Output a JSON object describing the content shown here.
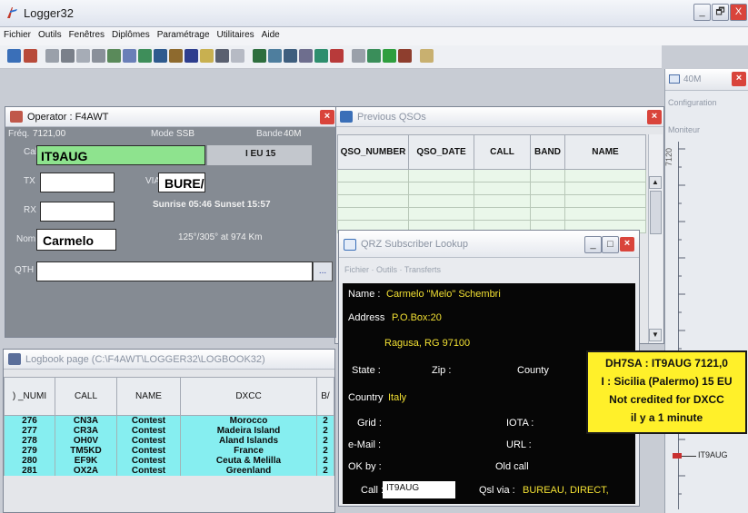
{
  "app": {
    "title": "Logger32",
    "window_buttons": [
      "_",
      "🗗",
      "X"
    ]
  },
  "menu": [
    "Fichier",
    "Outils",
    "Fenêtres",
    "Diplômes",
    "Paramétrage",
    "Utilitaires",
    "Aide"
  ],
  "operator": {
    "title": "Operator : F4AWT",
    "freq_label": "Fréq.",
    "freq": "7121,00",
    "mode_label": "Mode",
    "mode": "SSB",
    "band_label": "Bande",
    "band": "40M",
    "call_label": "Call",
    "call": "IT9AUG",
    "zone": "I EU 15",
    "tx_label": "TX",
    "via_label": "VIA",
    "via": "BURE/",
    "rx_label": "RX",
    "sun": "Sunrise 05:46 Sunset 15:57",
    "beam": "125°/305° at 974 Km",
    "nom_label": "Nom",
    "nom": "Carmelo",
    "qth_label": "QTH",
    "qth_btn": "..."
  },
  "previous_qsos": {
    "title": "Previous QSOs",
    "columns": [
      "QSO_NUMBER",
      "QSO_DATE",
      "CALL",
      "BAND",
      "NAME"
    ]
  },
  "qrz": {
    "title": "QRZ Subscriber Lookup",
    "menu": "Fichier · Outils · Transferts",
    "name_label": "Name :",
    "name": "Carmelo \"Melo\" Schembri",
    "address_label": "Address",
    "address": "P.O.Box:20",
    "city": "Ragusa, RG 97100",
    "state_label": "State :",
    "zip_label": "Zip :",
    "county_label": "County",
    "country_label": "Country",
    "country": "Italy",
    "grid_label": "Grid :",
    "iota_label": "IOTA :",
    "email_label": "e-Mail :",
    "url_label": "URL :",
    "okby_label": "OK by :",
    "oldcall_label": "Old call",
    "call_label": "Call :",
    "call": "IT9AUG",
    "qsl_label": "Qsl via :",
    "qsl": "BUREAU, DIRECT,"
  },
  "logbook": {
    "title": "Logbook page (C:\\F4AWT\\LOGGER32\\LOGBOOK32)",
    "columns": [
      ") _NUMI",
      "CALL",
      "NAME",
      "DXCC",
      "B/"
    ],
    "rows": [
      [
        "276",
        "CN3A",
        "Contest",
        "Morocco",
        "2"
      ],
      [
        "277",
        "CR3A",
        "Contest",
        "Madeira Island",
        "2"
      ],
      [
        "278",
        "OH0V",
        "Contest",
        "Aland Islands",
        "2"
      ],
      [
        "279",
        "TM5KD",
        "Contest",
        "France",
        "2"
      ],
      [
        "280",
        "EF9K",
        "Contest",
        "Ceuta & Melilla",
        "2"
      ],
      [
        "281",
        "OX2A",
        "Contest",
        "Greenland",
        "2"
      ]
    ]
  },
  "bandmap": {
    "title": "40M",
    "configuration": "Configuration",
    "moniteur": "Moniteur",
    "scale": "7120",
    "spot": "IT9AUG"
  },
  "tooltip": {
    "line1": "DH7SA : IT9AUG  7121,0",
    "line2": "I : Sicilia (Palermo)  15  EU",
    "line3": "Not credited for DXCC",
    "line4": "il y a 1 minute"
  },
  "colors": {
    "call_field": "#8ee38e",
    "tooltip": "#fff02a",
    "logbook_row": "#86eef0",
    "qrz_value": "#f2e033"
  }
}
